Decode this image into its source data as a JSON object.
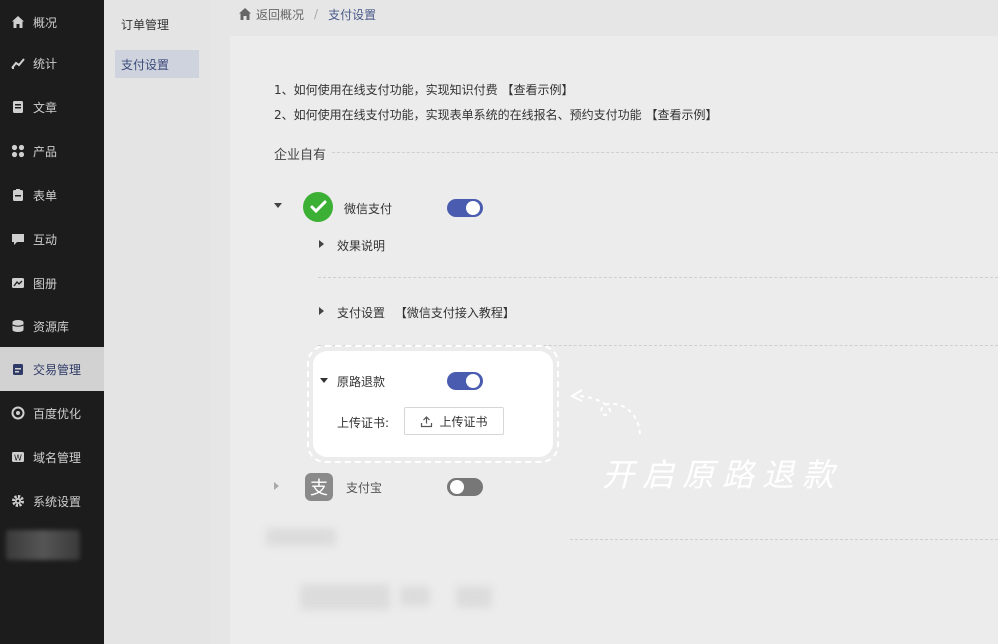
{
  "sidebar": {
    "items": [
      {
        "label": "概况",
        "icon": "home-icon"
      },
      {
        "label": "统计",
        "icon": "chart-icon"
      },
      {
        "label": "文章",
        "icon": "article-icon"
      },
      {
        "label": "产品",
        "icon": "grid-icon"
      },
      {
        "label": "表单",
        "icon": "clipboard-icon"
      },
      {
        "label": "互动",
        "icon": "chat-icon"
      },
      {
        "label": "图册",
        "icon": "album-icon"
      },
      {
        "label": "资源库",
        "icon": "database-icon"
      },
      {
        "label": "交易管理",
        "icon": "trade-icon"
      },
      {
        "label": "百度优化",
        "icon": "seo-icon"
      },
      {
        "label": "域名管理",
        "icon": "domain-icon"
      },
      {
        "label": "系统设置",
        "icon": "gear-icon"
      }
    ],
    "active_index": 8
  },
  "submenu": {
    "items": [
      {
        "label": "订单管理"
      },
      {
        "label": "支付设置"
      }
    ],
    "active_index": 1
  },
  "breadcrumb": {
    "back": "返回概况",
    "separator": "/",
    "current": "支付设置"
  },
  "help": {
    "line1": "1、如何使用在线支付功能，实现知识付费 【查看示例】",
    "line2": "2、如何使用在线支付功能，实现表单系统的在线报名、预约支付功能 【查看示例】"
  },
  "section": {
    "title": "企业自有"
  },
  "wechat": {
    "label": "微信支付",
    "enabled": true,
    "effect_label": "效果说明",
    "settings_label": "支付设置",
    "settings_link": "【微信支付接入教程】",
    "refund_label": "原路退款",
    "refund_enabled": true,
    "cert_label": "上传证书:",
    "cert_button": "上传证书"
  },
  "alipay": {
    "label": "支付宝",
    "logo_char": "支",
    "enabled": false
  },
  "annotation": {
    "text": "开启原路退款"
  },
  "colors": {
    "sidebar_bg": "#1c1c1c",
    "accent": "#4a5cb0",
    "wechat_green": "#3cb035"
  }
}
